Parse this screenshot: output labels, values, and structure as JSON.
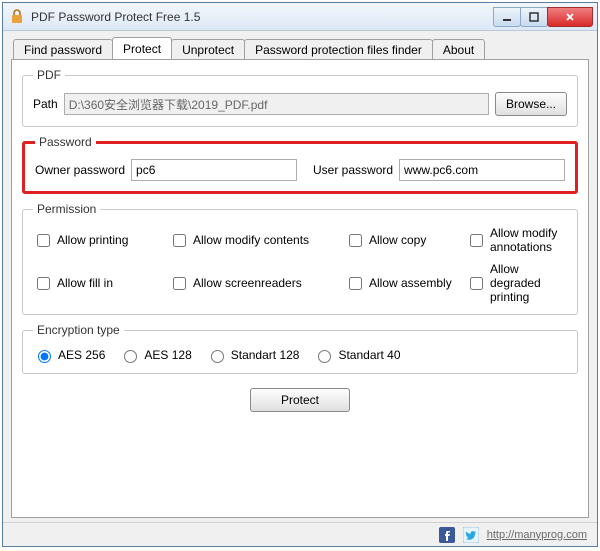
{
  "window": {
    "title": "PDF Password Protect Free 1.5"
  },
  "tabs": [
    {
      "label": "Find password"
    },
    {
      "label": "Protect"
    },
    {
      "label": "Unprotect"
    },
    {
      "label": "Password protection files finder"
    },
    {
      "label": "About"
    }
  ],
  "active_tab_index": 1,
  "pdf": {
    "legend": "PDF",
    "path_label": "Path",
    "path_value": "D:\\360安全浏览器下载\\2019_PDF.pdf",
    "browse_label": "Browse..."
  },
  "password": {
    "legend": "Password",
    "owner_label": "Owner password",
    "owner_value": "pc6",
    "user_label": "User password",
    "user_value": "www.pc6.com"
  },
  "permission": {
    "legend": "Permission",
    "items": [
      {
        "label": "Allow printing",
        "checked": false
      },
      {
        "label": "Allow modify contents",
        "checked": false
      },
      {
        "label": "Allow copy",
        "checked": false
      },
      {
        "label": "Allow modify annotations",
        "checked": false
      },
      {
        "label": "Allow fill in",
        "checked": false
      },
      {
        "label": "Allow screenreaders",
        "checked": false
      },
      {
        "label": "Allow assembly",
        "checked": false
      },
      {
        "label": "Allow degraded printing",
        "checked": false
      }
    ]
  },
  "encryption": {
    "legend": "Encryption type",
    "options": [
      {
        "label": "AES 256",
        "checked": true
      },
      {
        "label": "AES 128",
        "checked": false
      },
      {
        "label": "Standart 128",
        "checked": false
      },
      {
        "label": "Standart 40",
        "checked": false
      }
    ]
  },
  "actions": {
    "protect_label": "Protect"
  },
  "status": {
    "link": "http://manyprog.com"
  }
}
